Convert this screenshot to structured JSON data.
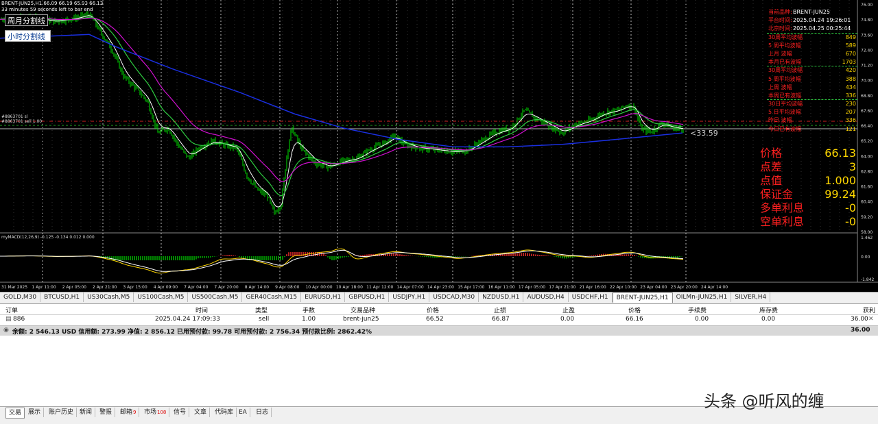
{
  "chart": {
    "header": "BRENT-JUN25,H1  66.09 66.19 65.93 66.13",
    "timer": "33 minutes 59 seconds left to bar end",
    "week_split_button": "周月分割线",
    "hour_split_button": "小时分割线",
    "order_label_sl": "#8863701 sl",
    "order_label_sell": "#8863701 sell 1.00",
    "pip_distance_label": "<33.59",
    "macd_label": "myMACD(12,26,9) -0.125 -0.134 0.012 0.000",
    "price_axis_labels": [
      "76.00",
      "74.80",
      "73.60",
      "72.40",
      "71.20",
      "70.00",
      "68.80",
      "67.60",
      "66.40",
      "65.20",
      "64.00",
      "62.80",
      "61.60",
      "60.40",
      "59.20",
      "58.00"
    ],
    "macd_axis_labels": [
      "1.462",
      "0.00",
      "-1.842"
    ],
    "time_axis_labels": [
      "31 Mar 2025",
      "1 Apr 11:00",
      "2 Apr 05:00",
      "2 Apr 21:00",
      "3 Apr 15:00",
      "4 Apr 09:00",
      "7 Apr 04:00",
      "7 Apr 20:00",
      "8 Apr 14:00",
      "9 Apr 08:00",
      "10 Apr 00:00",
      "10 Apr 18:00",
      "11 Apr 12:00",
      "14 Apr 07:00",
      "14 Apr 23:00",
      "15 Apr 17:00",
      "16 Apr 11:00",
      "17 Apr 05:00",
      "17 Apr 21:00",
      "21 Apr 16:00",
      "22 Apr 10:00",
      "23 Apr 04:00",
      "23 Apr 20:00",
      "24 Apr 14:00"
    ],
    "colors": {
      "candle": "#00e000",
      "ma_fast": "#ffffff",
      "ma_green": "#2ecc40",
      "ma_magenta": "#d010d0",
      "ma_blue": "#1a2fe0",
      "macd_line": "#ffd700",
      "signal_line": "#ffffff",
      "hist_up": "#ff3030",
      "hist_down": "#00c000"
    }
  },
  "info_panel": {
    "rows": [
      {
        "label": "当前品种:",
        "value": "BRENT-JUN25"
      },
      {
        "label": "平台时间:",
        "value": "2025.04.24 19:26:01"
      },
      {
        "label": "北京时间:",
        "value": "2025.04.25 00:25:44"
      },
      {
        "label": "30周平均波幅",
        "value": "849"
      },
      {
        "label": "5 周平均波幅",
        "value": "589"
      },
      {
        "label": "上月    波幅",
        "value": "670"
      },
      {
        "label": "本月已有波幅",
        "value": "1703"
      },
      {
        "label": "30周平均波幅",
        "value": "420"
      },
      {
        "label": "5 周平均波幅",
        "value": "388"
      },
      {
        "label": "上周    波幅",
        "value": "434"
      },
      {
        "label": "本周已有波幅",
        "value": "336"
      },
      {
        "label": "30日平均波幅",
        "value": "230"
      },
      {
        "label": "5 日平均波幅",
        "value": "207"
      },
      {
        "label": "昨日    波幅",
        "value": "336"
      },
      {
        "label": "今日已有波幅",
        "value": "121"
      }
    ],
    "big": [
      {
        "label": "价格",
        "value": "66.13"
      },
      {
        "label": "点差",
        "value": "3"
      },
      {
        "label": "点值",
        "value": "1.000"
      },
      {
        "label": "保证金",
        "value": "99.24"
      },
      {
        "label": "多单利息",
        "value": "-0"
      },
      {
        "label": "空单利息",
        "value": "-0"
      }
    ]
  },
  "symbol_tabs": [
    "GOLD,M30",
    "BTCUSD,H1",
    "US30Cash,M5",
    "US100Cash,M5",
    "US500Cash,M5",
    "GER40Cash,M15",
    "EURUSD,H1",
    "GBPUSD,H1",
    "USDJPY,H1",
    "USDCAD,M30",
    "NZDUSD,H1",
    "AUDUSD,H4",
    "USDCHF,H1",
    "BRENT-JUN25,H1",
    "OILMn-JUN25,H1",
    "SILVER,H4"
  ],
  "active_symbol_tab": 13,
  "terminal": {
    "headers": {
      "order": "订单",
      "time": "时间",
      "type": "类型",
      "lots": "手数",
      "symbol": "交易品种",
      "price": "价格",
      "sl": "止损",
      "tp": "止盈",
      "cur_price": "价格",
      "commission": "手续费",
      "swap": "库存费",
      "profit": "获利"
    },
    "row": {
      "order": "886",
      "time": "2025.04.24 17:09:33",
      "type": "sell",
      "lots": "1.00",
      "symbol": "brent-jun25",
      "price": "66.52",
      "sl": "66.87",
      "tp": "0.00",
      "cur_price": "66.16",
      "commission": "0.00",
      "swap": "0.00",
      "profit": "36.00"
    },
    "summary": "余额: 2 546.13 USD  信用额: 273.99  净值: 2 856.12  已用预付款: 99.78  可用预付款: 2 756.34  预付款比例: 2862.42%",
    "summary_profit": "36.00"
  },
  "bottom_tabs": [
    {
      "label": "交易",
      "badge": ""
    },
    {
      "label": "展示",
      "badge": ""
    },
    {
      "label": "账户历史",
      "badge": ""
    },
    {
      "label": "新闻",
      "badge": ""
    },
    {
      "label": "警报",
      "badge": ""
    },
    {
      "label": "邮箱",
      "badge": "9"
    },
    {
      "label": "市场",
      "badge": "108"
    },
    {
      "label": "信号",
      "badge": ""
    },
    {
      "label": "文章",
      "badge": ""
    },
    {
      "label": "代码库",
      "badge": ""
    },
    {
      "label": "EA",
      "badge": ""
    },
    {
      "label": "日志",
      "badge": ""
    }
  ],
  "watermark": "头条 @听风的缠"
}
